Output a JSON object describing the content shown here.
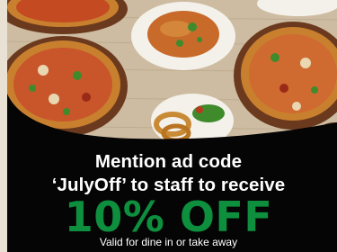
{
  "promo": {
    "headline_line_1": "Mention ad code",
    "headline_line_2": "‘JulyOff’ to staff to receive",
    "discount": "10% OFF",
    "footnote": "Valid for dine in or take away"
  },
  "colors": {
    "panel": "#050505",
    "discount": "#0e8f3e",
    "text": "#ffffff",
    "table_wood": "#c9b79c",
    "pizza_crust": "#c9802e",
    "tomato": "#b53a1e",
    "basil": "#3f8b2c",
    "plate": "#f4f1ea"
  },
  "icons": [
    "pizza-image",
    "pasta-image",
    "salad-image",
    "onion-rings-image"
  ]
}
